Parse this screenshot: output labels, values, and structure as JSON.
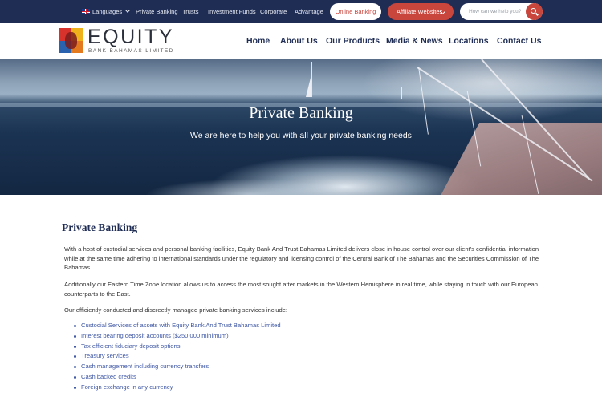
{
  "topbar": {
    "languages_label": "Languages",
    "links": [
      "Private Banking",
      "Trusts",
      "Investment Funds",
      "Corporate",
      "Advantage"
    ],
    "online_banking": "Online Banking",
    "affiliate_websites": "Affiliate Websites",
    "search_placeholder": "How can we help you?"
  },
  "brand": {
    "name": "EQUITY",
    "tagline": "BANK   BAHAMAS LIMITED"
  },
  "nav": [
    "Home",
    "About Us",
    "Our Products",
    "Media & News",
    "Locations",
    "Contact Us"
  ],
  "hero": {
    "title": "Private Banking",
    "subtitle": "We are here to help you with all your private banking needs"
  },
  "content": {
    "title": "Private Banking",
    "paragraphs": [
      "With a host of custodial services and personal banking facilities, Equity Bank And Trust Bahamas Limited delivers close in house control over our client's confidential information while at the same time adhering to international standards under the regulatory and licensing control of the Central Bank of The Bahamas and the Securities Commission of The Bahamas.",
      "Additionally our Eastern Time Zone location allows us to access the most sought after markets in the Western Hemisphere in real time, while staying in touch with our European counterparts to the East.",
      "Our efficiently conducted and discreetly managed private banking services include:"
    ],
    "services": [
      "Custodial Services of assets with Equity Bank And Trust Bahamas Limited",
      "Interest bearing deposit accounts ($250,000 minimum)",
      "Tax efficient fiduciary deposit options",
      "Treasury services",
      "Cash management including currency transfers",
      "Cash backed credits",
      "Foreign exchange in any currency"
    ]
  },
  "colors": {
    "navy": "#1f2d55",
    "accent_red": "#c9463d",
    "link_blue": "#3d56a3"
  },
  "icons": [
    "uk-flag-icon",
    "chevron-down-icon",
    "search-icon",
    "list-bullet-icon"
  ]
}
